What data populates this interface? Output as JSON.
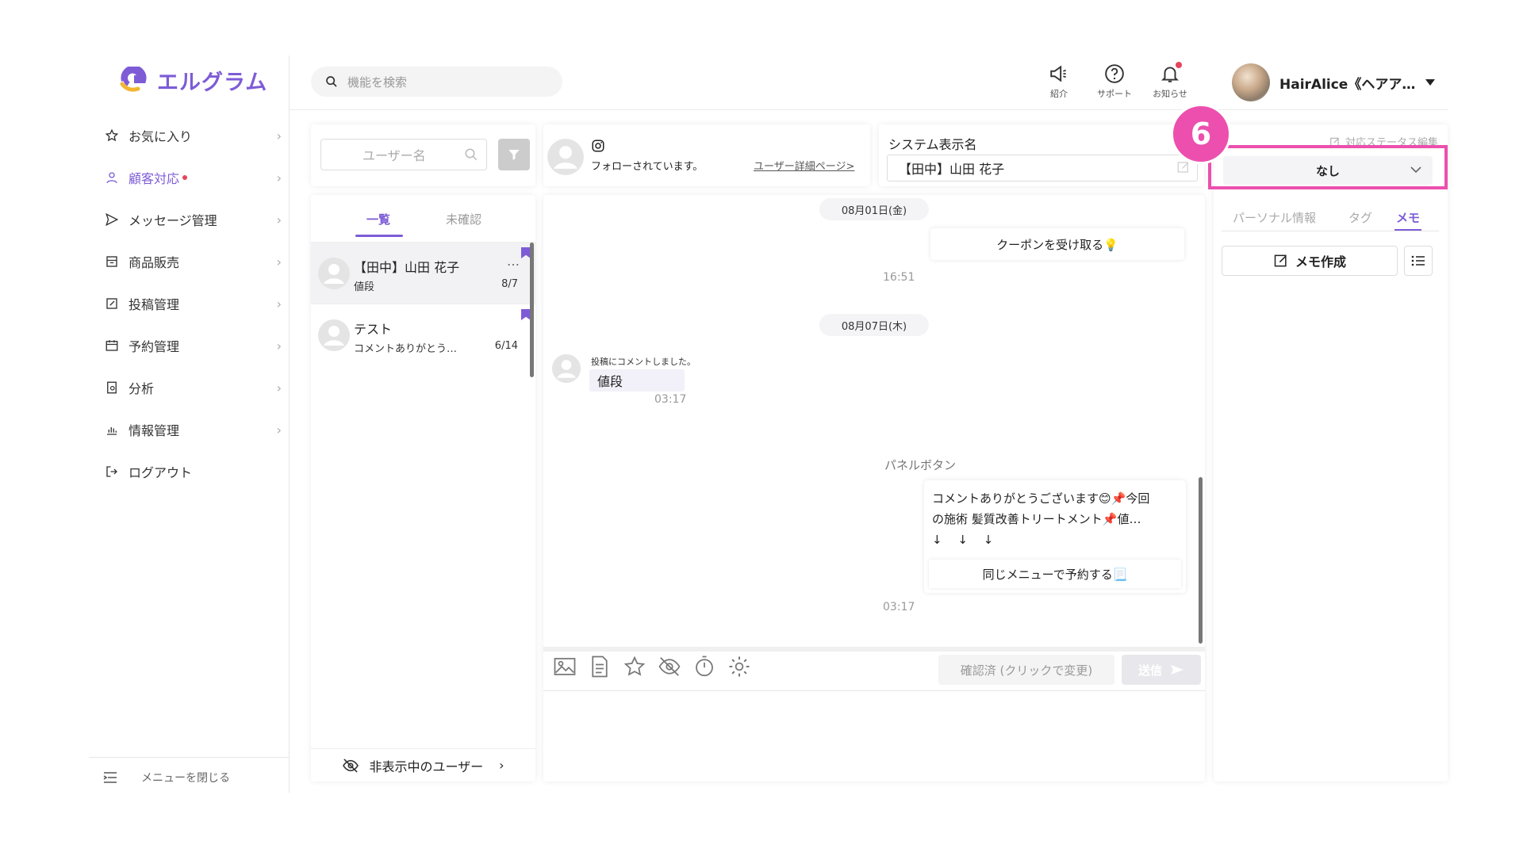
{
  "app": {
    "logo_text": "エルグラム"
  },
  "search": {
    "placeholder": "機能を検索"
  },
  "sidebar": {
    "items": [
      {
        "label": "お気に入り"
      },
      {
        "label": "顧客対応"
      },
      {
        "label": "メッセージ管理"
      },
      {
        "label": "商品販売"
      },
      {
        "label": "投稿管理"
      },
      {
        "label": "予約管理"
      },
      {
        "label": "分析"
      },
      {
        "label": "情報管理"
      },
      {
        "label": "ログアウト"
      }
    ],
    "close_label": "メニューを閉じる"
  },
  "topbar": {
    "intro_label": "紹介",
    "support_label": "サポート",
    "notice_label": "お知らせ",
    "user_name": "HairAlice《ヘアア…"
  },
  "user_list": {
    "search_placeholder": "ユーザー名",
    "tabs": [
      "一覧",
      "未確認"
    ],
    "rows": [
      {
        "name": "【田中】山田 花子",
        "preview": "値段",
        "date": "8/7",
        "more": "…"
      },
      {
        "name": "テスト",
        "preview": "コメントありがとう…",
        "date": "6/14"
      }
    ],
    "hidden_users_label": "非表示中のユーザー"
  },
  "chat_header": {
    "following_text": "フォローされています。",
    "detail_link": "ユーザー詳細ページ>"
  },
  "system_name": {
    "label": "システム表示名",
    "value": "【田中】山田 花子"
  },
  "chat": {
    "date1": "08月01日(金)",
    "coupon_button": "クーポンを受け取る💡",
    "time1": "16:51",
    "date2": "08月07日(木)",
    "comment_note": "投稿にコメントしました。",
    "comment_text": "値段",
    "time2": "03:17",
    "panel_title": "パネルボタン",
    "panel_text_line1": "コメントありがとうございます😊📌今回",
    "panel_text_line2": "の施術 髪質改善トリートメント📌値…",
    "panel_text_line3": "↓　 ↓　 ↓",
    "panel_button": "同じメニューで予約する📃",
    "time3": "03:17",
    "confirm_button": "確認済 (クリックで変更)",
    "send_button": "送信"
  },
  "right_panel": {
    "status_edit_label": "対応ステータス編集",
    "status_value": "なし",
    "tabs": [
      "パーソナル情報",
      "タグ",
      "メモ"
    ],
    "memo_create": "メモ作成"
  },
  "annotation": {
    "step_number": "6"
  },
  "colors": {
    "accent": "#7d5cd6",
    "highlight": "#ec4fae",
    "notify": "#e6445b"
  }
}
